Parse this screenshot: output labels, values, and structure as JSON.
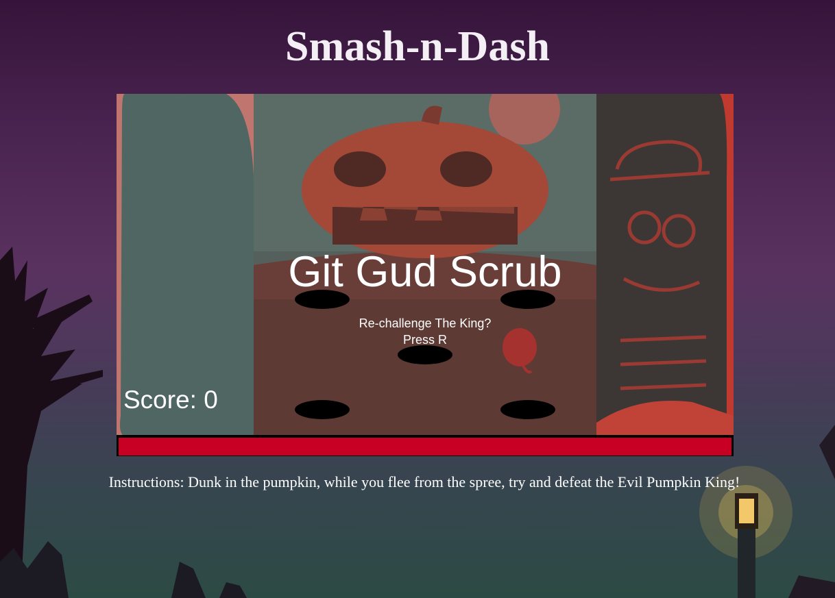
{
  "page": {
    "title": "Smash-n-Dash",
    "instructions": "Instructions: Dunk in the pumpkin, while you flee from the spree, try and defeat the Evil Pumpkin King!"
  },
  "game": {
    "score_text": "Score: 0",
    "gameover_title": "Git Gud Scrub",
    "gameover_line1": "Re-challenge The King?",
    "gameover_line2": "Press R",
    "health_fraction": 1.0,
    "colors": {
      "health_bar": "#c80024",
      "arena_tint": "#6b3a34",
      "left_panel": "#4f6662",
      "right_panel": "#3c3735"
    },
    "sprites": [
      "pumpkin-king-icon",
      "small-pumpkin-icon",
      "moon-icon",
      "skeleton-hat-icon"
    ]
  }
}
